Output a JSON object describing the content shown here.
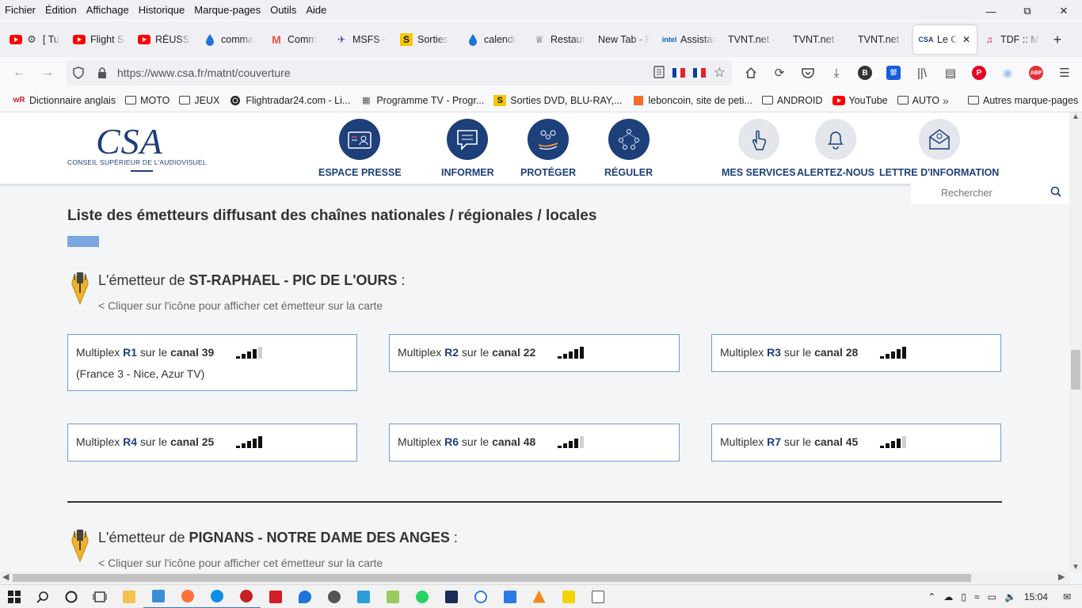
{
  "menubar": {
    "items": [
      "Fichier",
      "Édition",
      "Affichage",
      "Historique",
      "Marque-pages",
      "Outils",
      "Aide"
    ]
  },
  "tabs": [
    {
      "title": "[ Tu",
      "icon": "youtube-icon",
      "color": "#ff0000"
    },
    {
      "title": "Flight Si",
      "icon": "youtube-icon",
      "color": "#ff0000"
    },
    {
      "title": "RÉUSSIR",
      "icon": "youtube-icon",
      "color": "#ff0000"
    },
    {
      "title": "comma",
      "icon": "drop-icon",
      "color": "#1e73d8"
    },
    {
      "title": "Comm",
      "icon": "m-icon",
      "color": "#e5533d"
    },
    {
      "title": "MSFS –",
      "icon": "plane-icon",
      "color": "#2a4f9e"
    },
    {
      "title": "Sorties",
      "icon": "s-icon",
      "color": "#d9a400"
    },
    {
      "title": "calendr",
      "icon": "drop-icon",
      "color": "#1e73d8"
    },
    {
      "title": "Restaur",
      "icon": "chef-icon",
      "color": "#444444"
    },
    {
      "title": "New Tab - F",
      "icon": "none",
      "color": "#444444"
    },
    {
      "title": "Assistar",
      "icon": "intel-icon",
      "color": "#0068b5"
    },
    {
      "title": "TVNT.net -",
      "icon": "none",
      "color": "#444444"
    },
    {
      "title": "TVNT.net -",
      "icon": "none",
      "color": "#444444"
    },
    {
      "title": "TVNT.net -",
      "icon": "none",
      "color": "#444444"
    },
    {
      "title": "Le C",
      "icon": "csa-icon",
      "color": "#1d3f7a",
      "active": true
    },
    {
      "title": "TDF :: M",
      "icon": "tdf-icon",
      "color": "#d22"
    }
  ],
  "navbar": {
    "url": "https://www.csa.fr/matnt/couverture"
  },
  "bookmarks": [
    {
      "label": "Dictionnaire anglais",
      "type": "link",
      "icon": "wr-icon"
    },
    {
      "label": "MOTO",
      "type": "folder"
    },
    {
      "label": "JEUX",
      "type": "folder"
    },
    {
      "label": "Flightradar24.com - Li...",
      "type": "link",
      "icon": "radar-icon"
    },
    {
      "label": "Programme TV - Progr...",
      "type": "link",
      "icon": "tv-icon"
    },
    {
      "label": "Sorties DVD, BLU-RAY,...",
      "type": "link",
      "icon": "s-icon"
    },
    {
      "label": "leboncoin, site de peti...",
      "type": "link",
      "icon": "leboncoin-icon"
    },
    {
      "label": "ANDROID",
      "type": "folder"
    },
    {
      "label": "YouTube",
      "type": "link",
      "icon": "youtube-icon"
    },
    {
      "label": "AUTO",
      "type": "folder"
    }
  ],
  "bookmarks_other": "Autres marque-pages",
  "site": {
    "logo_letters": "CSA",
    "logo_subtitle": "CONSEIL SUPÉRIEUR DE L'AUDIOVISUEL",
    "nav": [
      {
        "label": "ESPACE PRESSE",
        "icon": "press-card-icon",
        "style": "dark"
      },
      {
        "label": "INFORMER",
        "icon": "chat-icon",
        "style": "dark"
      },
      {
        "label": "PROTÉGER",
        "icon": "people-hand-icon",
        "style": "dark"
      },
      {
        "label": "RÉGULER",
        "icon": "network-people-icon",
        "style": "dark"
      },
      {
        "label": "MES SERVICES",
        "icon": "hand-pointer-icon",
        "style": "light"
      },
      {
        "label": "ALERTEZ-NOUS",
        "icon": "bell-icon",
        "style": "light"
      },
      {
        "label": "LETTRE D'INFORMATION",
        "icon": "newsletter-icon",
        "style": "light"
      }
    ],
    "search_placeholder": "Rechercher"
  },
  "page_title": "Liste des émetteurs diffusant des chaînes nationales / régionales / locales",
  "emitters": [
    {
      "prefix": "L'émetteur de ",
      "name": "ST-RAPHAEL - PIC DE L'OURS",
      "suffix": " :",
      "hint": "< Cliquer sur l'icône pour afficher cet émetteur sur la carte",
      "multiplexes": [
        {
          "label": "Multiplex ",
          "id": "R1",
          "mid": " sur le ",
          "canal": "canal 39",
          "signal": 4,
          "detail": "(France 3 - Nice, Azur TV)"
        },
        {
          "label": "Multiplex ",
          "id": "R2",
          "mid": " sur le ",
          "canal": "canal 22",
          "signal": 5
        },
        {
          "label": "Multiplex ",
          "id": "R3",
          "mid": " sur le ",
          "canal": "canal 28",
          "signal": 5
        },
        {
          "label": "Multiplex ",
          "id": "R4",
          "mid": " sur le ",
          "canal": "canal 25",
          "signal": 5
        },
        {
          "label": "Multiplex ",
          "id": "R6",
          "mid": " sur le ",
          "canal": "canal 48",
          "signal": 4
        },
        {
          "label": "Multiplex ",
          "id": "R7",
          "mid": " sur le ",
          "canal": "canal 45",
          "signal": 4
        }
      ]
    },
    {
      "prefix": "L'émetteur de ",
      "name": "PIGNANS - NOTRE DAME DES ANGES",
      "suffix": " :",
      "hint": "< Cliquer sur l'icône pour afficher cet émetteur sur la carte"
    }
  ],
  "colors": {
    "brand": "#1d3f7a",
    "box_border": "#6f9ed6",
    "accent_bar": "#7ba7e0"
  },
  "taskbar": {
    "clock": "15:04"
  }
}
